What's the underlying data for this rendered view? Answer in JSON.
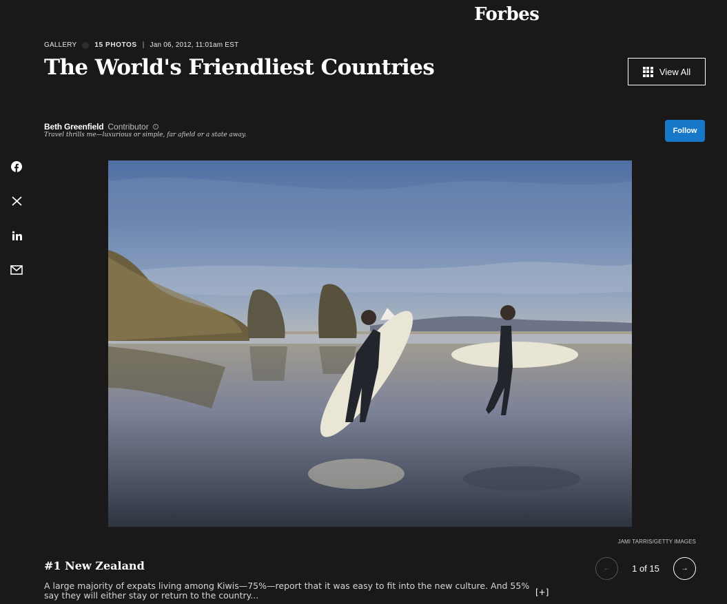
{
  "header": {
    "logo": "Forbes"
  },
  "meta": {
    "type": "GALLERY",
    "photo_count": "15 PHOTOS",
    "separator": "|",
    "date": "Jan 06, 2012, 11:01am EST"
  },
  "title": "The World's Friendliest Countries",
  "view_all": {
    "label": "View All",
    "icon": "grid-icon"
  },
  "author": {
    "name": "Beth Greenfield",
    "role": "Contributor",
    "tagline": "Travel thrills me—luxurious or simple, far afield or a state away.",
    "follow_label": "Follow"
  },
  "social": [
    {
      "icon": "facebook-icon"
    },
    {
      "icon": "x-icon"
    },
    {
      "icon": "linkedin-icon"
    },
    {
      "icon": "email-icon"
    }
  ],
  "photo": {
    "credit": "JAMI TARRIS/GETTY IMAGES"
  },
  "slide": {
    "title": "#1 New Zealand",
    "description": "A large majority of expats living among Kiwis—75%—report that it was easy to fit into the new culture. And 55% say they will either stay or return to the country...",
    "expand_label": "[+]"
  },
  "pagination": {
    "current": "1 of 15",
    "prev_icon": "arrow-left-icon",
    "next_icon": "arrow-right-icon"
  },
  "colors": {
    "background": "#1a1818",
    "accent": "#1778c9"
  }
}
